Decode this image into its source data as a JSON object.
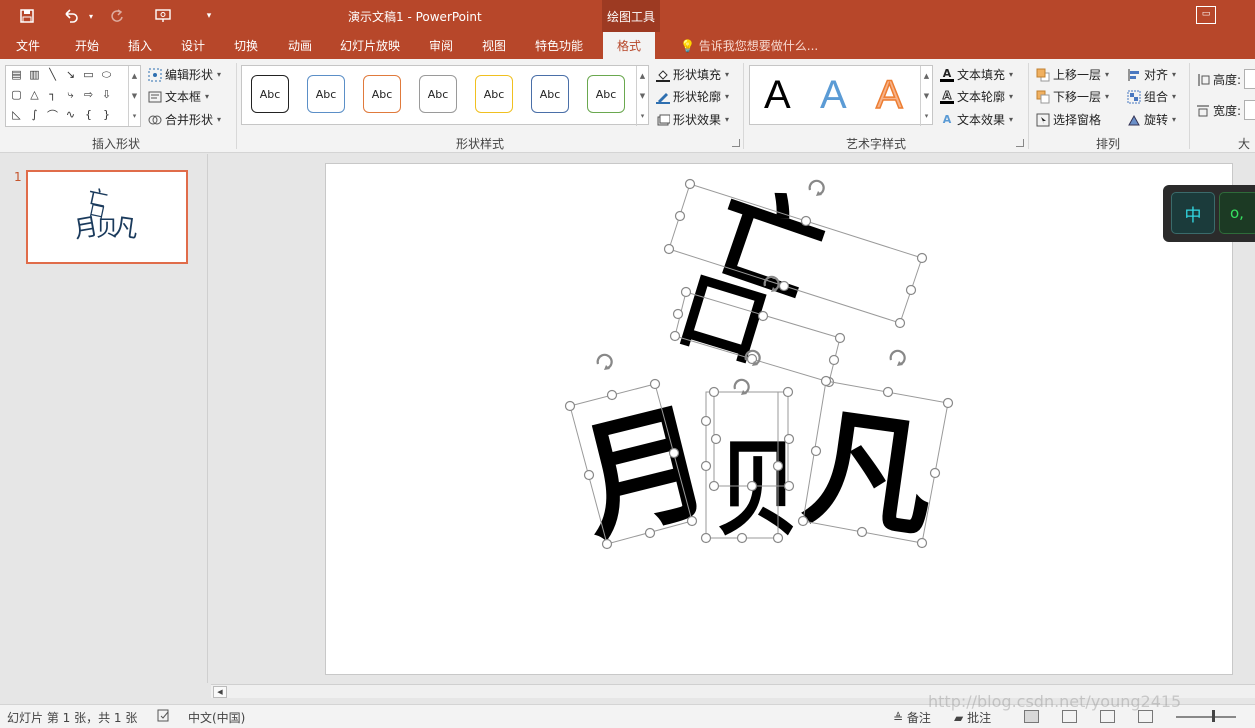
{
  "titlebar": {
    "doc_title": "演示文稿1 - PowerPoint",
    "context_group": "绘图工具",
    "save_icon": "save-icon",
    "undo_icon": "undo-icon",
    "redo_icon": "redo-icon",
    "customize_icon": "customize-quick-access-icon"
  },
  "tabs": [
    {
      "label": "文件"
    },
    {
      "label": "开始"
    },
    {
      "label": "插入"
    },
    {
      "label": "设计"
    },
    {
      "label": "切换"
    },
    {
      "label": "动画"
    },
    {
      "label": "幻灯片放映"
    },
    {
      "label": "审阅"
    },
    {
      "label": "视图"
    },
    {
      "label": "特色功能"
    },
    {
      "label": "格式"
    }
  ],
  "tell_me": "告诉我您想要做什么...",
  "ribbon": {
    "insert_shapes": {
      "label": "插入形状",
      "edit_shape": "编辑形状",
      "text_box": "文本框",
      "merge_shapes": "合并形状"
    },
    "shape_styles": {
      "label": "形状样式",
      "swatch_text": "Abc",
      "swatch_colors": [
        "#222222",
        "#5b8fc7",
        "#e07a3c",
        "#9a9a9a",
        "#f0c020",
        "#4a6fa8",
        "#6aa84f"
      ],
      "shape_fill": "形状填充",
      "shape_outline": "形状轮廓",
      "shape_effects": "形状效果"
    },
    "wordart_styles": {
      "label": "艺术字样式",
      "sample": "A",
      "text_fill": "文本填充",
      "text_outline": "文本轮廓",
      "text_effects": "文本效果"
    },
    "arrange": {
      "label": "排列",
      "bring_forward": "上移一层",
      "send_backward": "下移一层",
      "selection_pane": "选择窗格",
      "align": "对齐",
      "group": "组合",
      "rotate": "旋转"
    },
    "size": {
      "label": "大小",
      "height": "高度:",
      "width": "宽度:"
    }
  },
  "thumbnail": {
    "number": "1"
  },
  "slide_shapes": [
    "亡",
    "口",
    "月",
    "贝",
    "凡"
  ],
  "ime": {
    "mode": "中",
    "punct": "o,"
  },
  "statusbar": {
    "slide_info": "幻灯片 第 1 张，共 1 张",
    "language": "中文(中国)",
    "notes": "备注",
    "comments": "批注"
  },
  "watermark": "http://blog.csdn.net/young2415"
}
